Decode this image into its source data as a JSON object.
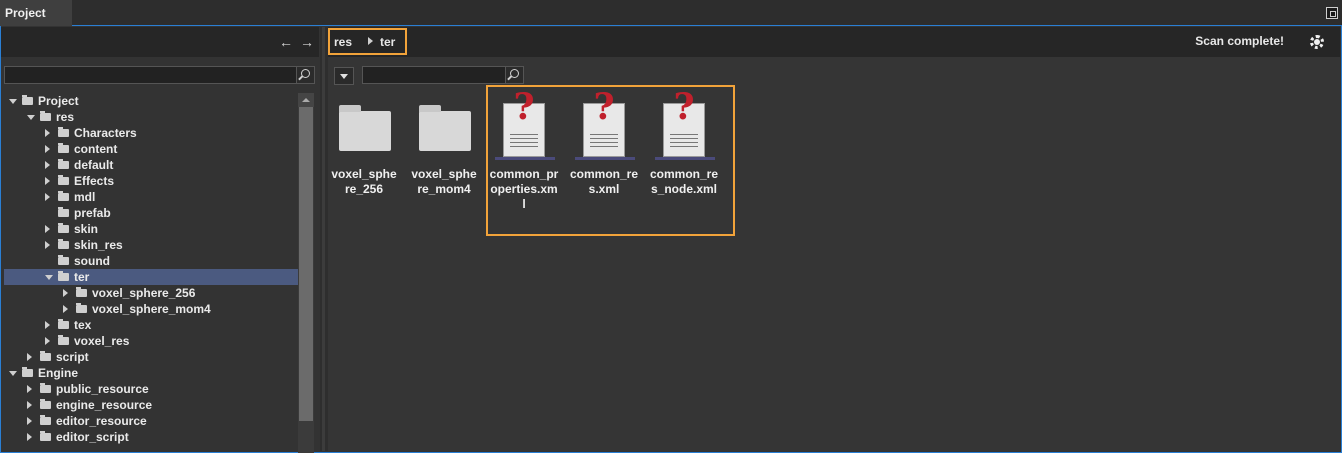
{
  "tab": {
    "title": "Project"
  },
  "left_toolbar": {
    "back_icon": "arrow-left-icon",
    "forward_icon": "arrow-right-icon"
  },
  "tree": [
    {
      "label": "Project",
      "depth": 0,
      "expander": "open",
      "folder_state": "open"
    },
    {
      "label": "res",
      "depth": 1,
      "expander": "open",
      "folder_state": "open"
    },
    {
      "label": "Characters",
      "depth": 2,
      "expander": "closed"
    },
    {
      "label": "content",
      "depth": 2,
      "expander": "closed"
    },
    {
      "label": "default",
      "depth": 2,
      "expander": "closed"
    },
    {
      "label": "Effects",
      "depth": 2,
      "expander": "closed"
    },
    {
      "label": "mdl",
      "depth": 2,
      "expander": "closed"
    },
    {
      "label": "prefab",
      "depth": 2,
      "expander": "none"
    },
    {
      "label": "skin",
      "depth": 2,
      "expander": "closed"
    },
    {
      "label": "skin_res",
      "depth": 2,
      "expander": "closed"
    },
    {
      "label": "sound",
      "depth": 2,
      "expander": "none"
    },
    {
      "label": "ter",
      "depth": 2,
      "expander": "open",
      "folder_state": "open",
      "selected": true
    },
    {
      "label": "voxel_sphere_256",
      "depth": 3,
      "expander": "closed"
    },
    {
      "label": "voxel_sphere_mom4",
      "depth": 3,
      "expander": "closed"
    },
    {
      "label": "tex",
      "depth": 2,
      "expander": "closed"
    },
    {
      "label": "voxel_res",
      "depth": 2,
      "expander": "closed"
    },
    {
      "label": "script",
      "depth": 1,
      "expander": "closed"
    },
    {
      "label": "Engine",
      "depth": 0,
      "expander": "open",
      "folder_state": "open"
    },
    {
      "label": "public_resource",
      "depth": 1,
      "expander": "closed"
    },
    {
      "label": "engine_resource",
      "depth": 1,
      "expander": "closed"
    },
    {
      "label": "editor_resource",
      "depth": 1,
      "expander": "closed"
    },
    {
      "label": "editor_script",
      "depth": 1,
      "expander": "closed"
    }
  ],
  "breadcrumb": {
    "parts": [
      "res",
      "ter"
    ]
  },
  "status": "Scan complete!",
  "items": [
    {
      "name": "voxel_sphere_256",
      "kind": "folder"
    },
    {
      "name": "voxel_sphere_mom4",
      "kind": "folder"
    },
    {
      "name": "common_properties.xml",
      "kind": "file"
    },
    {
      "name": "common_res.xml",
      "kind": "file"
    },
    {
      "name": "common_res_node.xml",
      "kind": "file"
    }
  ],
  "colors": {
    "accent": "#f2a33a",
    "frame": "#2a7fd4",
    "selection": "#4b5a80",
    "file_icon": "#c0202c"
  }
}
